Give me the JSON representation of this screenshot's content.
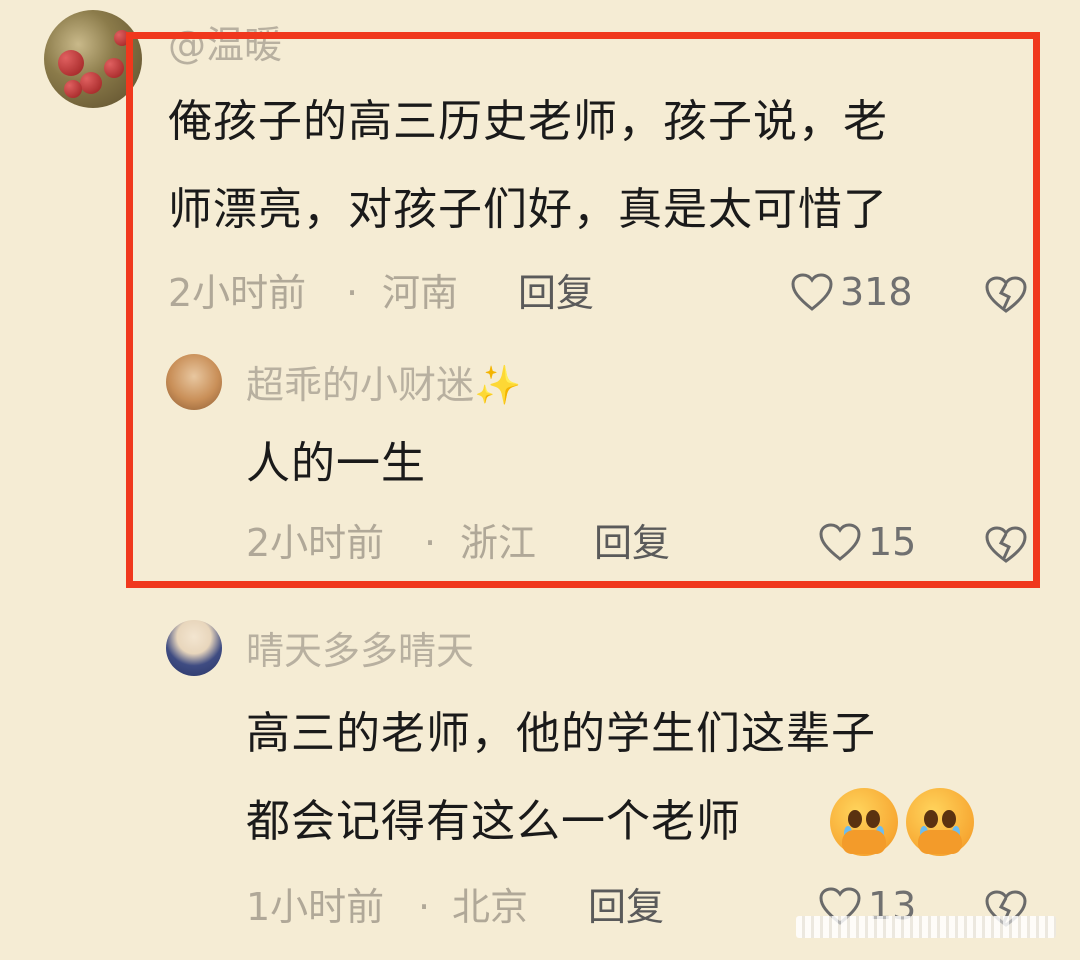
{
  "comment1": {
    "username": "@温暖",
    "text_line1": "俺孩子的高三历史老师，孩子说，老",
    "text_line2": "师漂亮，对孩子们好，真是太可惜了",
    "time": "2小时前",
    "separator": "·",
    "location": "河南",
    "reply_label": "回复",
    "likes": "318"
  },
  "reply1": {
    "username": "超乖的小财迷✨",
    "text": "人的一生",
    "time": "2小时前",
    "separator": "·",
    "location": "浙江",
    "reply_label": "回复",
    "likes": "15"
  },
  "comment2": {
    "username": "晴天多多晴天",
    "text_line1": "高三的老师，他的学生们这辈子",
    "text_line2": "都会记得有这么一个老师",
    "time": "1小时前",
    "separator": "·",
    "location": "北京",
    "reply_label": "回复",
    "likes": "13"
  },
  "colors": {
    "background": "#f5ecd4",
    "highlight_border": "#f0381d",
    "username": "#b8b0a0",
    "body": "#1a1a1a",
    "meta": "#b0a898"
  },
  "icons": {
    "like": "heart-outline-icon",
    "dislike": "broken-heart-icon",
    "emoji": "pleading-face-icon"
  }
}
